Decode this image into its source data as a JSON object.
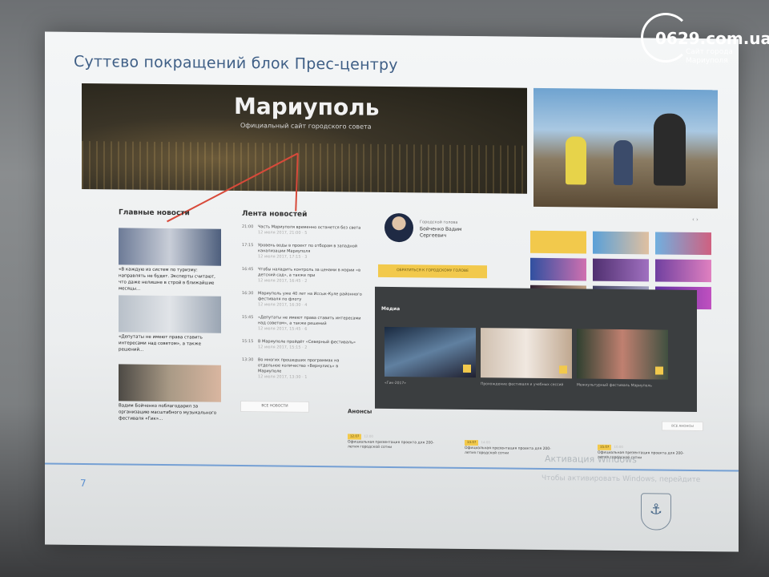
{
  "slide": {
    "title": "Суттєво покращений блок Прес-центру",
    "page_number": "7"
  },
  "hero": {
    "title": "Мариуполь",
    "subtitle": "Официальный сайт городского совета"
  },
  "main_news": {
    "title": "Главные новости",
    "items": [
      {
        "caption": "«В каждую из систем по туризму: направлять не будет. Эксперты считают, что даже нелишне в строй в ближайшие месяцы..."
      },
      {
        "caption": "«Депутаты не имеют права ставить интересами над советом», а также решений..."
      },
      {
        "caption": "Вадим Бойченко поблагодарил за организацию масштабного музыкального фестиваля «Гик»..."
      }
    ]
  },
  "feed": {
    "title": "Лента новостей",
    "items": [
      {
        "time": "21:00",
        "text": "Часть Мариуполя временно останется без света",
        "meta": "12 июля 2017, 21:00 · 5"
      },
      {
        "time": "17:15",
        "text": "Уровень воды в проект по отборам в западной канализации Мариуполя",
        "meta": "12 июля 2017, 17:15 · 3"
      },
      {
        "time": "16:45",
        "text": "Чтобы наладить контроль за ценами в мэрии «в детский сад», а также при",
        "meta": "12 июля 2017, 16:45 · 2"
      },
      {
        "time": "16:30",
        "text": "Мариуполь уже 40 лет на Иссык-Куле районного фестиваля по флоту",
        "meta": "12 июля 2017, 16:30 · 4"
      },
      {
        "time": "15:45",
        "text": "«Депутаты не имеют права ставить интересами над советом», а также решений",
        "meta": "12 июля 2017, 15:45 · 6"
      },
      {
        "time": "15:15",
        "text": "В Мариуполе пройдёт «Северный фестиваль»",
        "meta": "12 июля 2017, 15:15 · 2"
      },
      {
        "time": "13:30",
        "text": "Во многих прошедших программах на отдельное количество «Вернулись» в Мариуполе",
        "meta": "12 июля 2017, 13:30 · 1"
      }
    ],
    "all_button": "ВСЕ НОВОСТИ"
  },
  "mayor": {
    "role": "Городской голова",
    "name_line1": "Бойченко Вадим",
    "name_line2": "Сергеевич",
    "button": "ОБРАТИТЬСЯ К ГОРОДСКОМУ ГОЛОВЕ"
  },
  "media": {
    "title": "Медиа",
    "items": [
      {
        "caption": "«Гик-2017»"
      },
      {
        "caption": "Прохождение фестиваля и учебных сессий"
      },
      {
        "caption": "Межкультурный фестиваль Мариуполь"
      }
    ]
  },
  "announcements": {
    "title": "Анонсы",
    "all_button": "ВСЕ АНОНСЫ",
    "items": [
      {
        "tag": "12.07",
        "date": "12:00",
        "text": "Официальная презентация проекта для 200-летия городской сотни"
      },
      {
        "tag": "13.07",
        "date": "14:00",
        "text": "Официальная презентация проекта для 200-летия городской сотни"
      },
      {
        "tag": "15.07",
        "date": "10:00",
        "text": "Официальная презентация проекта для 200-летия городской сотни"
      }
    ]
  },
  "windows_watermark": {
    "line1": "Активация Windows",
    "line2": "Чтобы активировать Windows, перейдите"
  },
  "watermark": {
    "name": "0629.com.ua",
    "sub1": "Сайт города",
    "sub2": "Мариуполя"
  },
  "colors": {
    "title_blue": "#3f5f86",
    "accent_yellow": "#f2c94c",
    "arrow_red": "#d84a3a",
    "rule_blue": "#5a8fd0"
  }
}
